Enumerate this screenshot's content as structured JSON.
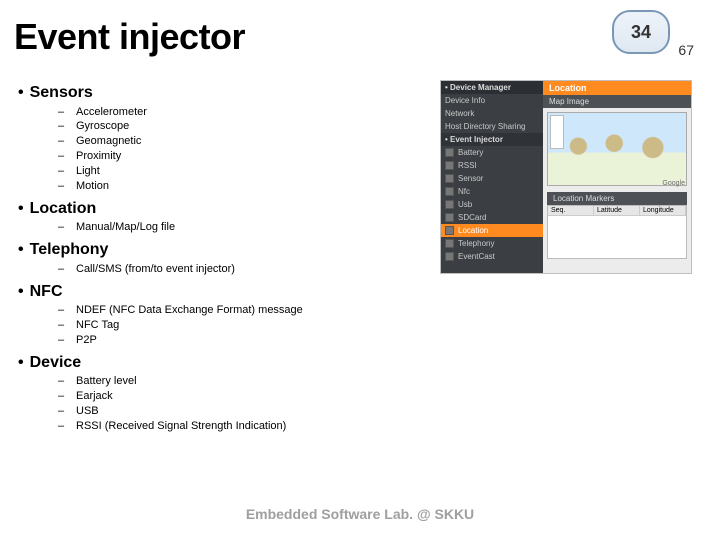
{
  "page": {
    "number": "34",
    "sub": "67"
  },
  "title": "Event injector",
  "footer": "Embedded Software Lab. @ SKKU",
  "bullets": [
    {
      "label": "Sensors",
      "subs": [
        "Accelerometer",
        "Gyroscope",
        "Geomagnetic",
        "Proximity",
        "Light",
        "Motion"
      ]
    },
    {
      "label": "Location",
      "subs": [
        "Manual/Map/Log file"
      ]
    },
    {
      "label": "Telephony",
      "subs": [
        "Call/SMS (from/to event injector)"
      ]
    },
    {
      "label": "NFC",
      "subs": [
        "NDEF (NFC Data Exchange Format) message",
        "NFC Tag",
        "P2P"
      ]
    },
    {
      "label": "Device",
      "subs": [
        "Battery level",
        "Earjack",
        "USB",
        "RSSI (Received Signal Strength Indication)"
      ]
    }
  ],
  "shot": {
    "left_header": "• Device Manager",
    "left_items_top": [
      "Device Info",
      "Network",
      "Host Directory Sharing"
    ],
    "left_sub": "• Event Injector",
    "left_items": [
      "Battery",
      "RSSI",
      "Sensor",
      "Nfc",
      "Usb",
      "SDCard",
      "Location",
      "Telephony",
      "EventCast"
    ],
    "left_selected_index": 6,
    "right_title": "Location",
    "right_panel": "Map Image",
    "markers_title": "Location Markers",
    "table_headers": [
      "Seq.",
      "Latitude",
      "Longitude"
    ],
    "map_provider": "Google"
  }
}
